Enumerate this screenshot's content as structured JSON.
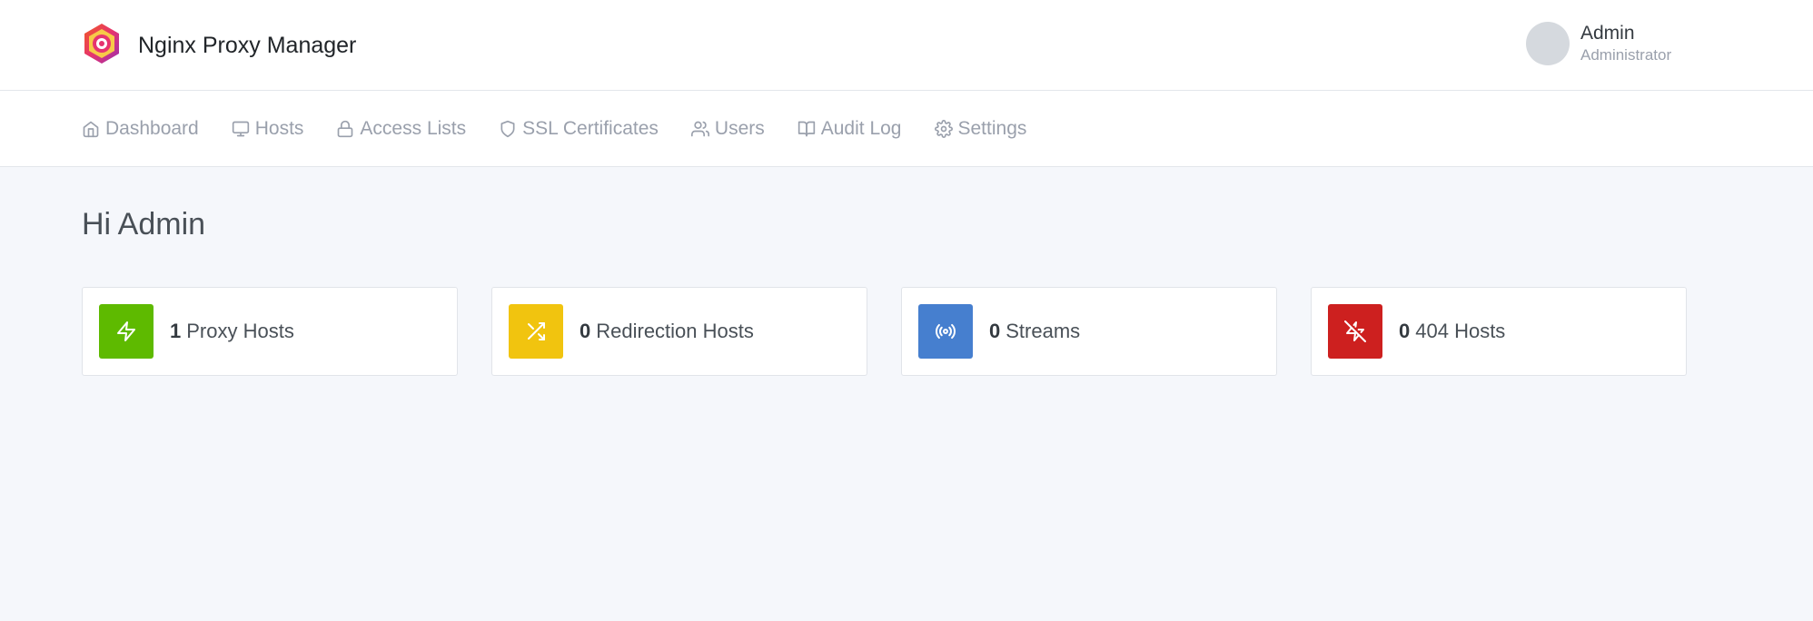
{
  "app": {
    "name": "Nginx Proxy Manager"
  },
  "user": {
    "name": "Admin",
    "role": "Administrator"
  },
  "nav": {
    "items": [
      {
        "label": "Dashboard",
        "icon": "home-icon"
      },
      {
        "label": "Hosts",
        "icon": "monitor-icon"
      },
      {
        "label": "Access Lists",
        "icon": "lock-icon"
      },
      {
        "label": "SSL Certificates",
        "icon": "shield-icon"
      },
      {
        "label": "Users",
        "icon": "users-icon"
      },
      {
        "label": "Audit Log",
        "icon": "book-icon"
      },
      {
        "label": "Settings",
        "icon": "gear-icon"
      }
    ]
  },
  "main": {
    "greeting": "Hi Admin",
    "cards": [
      {
        "count": "1",
        "label": "Proxy Hosts",
        "icon": "zap-icon",
        "color": "#5eba00"
      },
      {
        "count": "0",
        "label": "Redirection Hosts",
        "icon": "shuffle-icon",
        "color": "#f1c40f"
      },
      {
        "count": "0",
        "label": "Streams",
        "icon": "radio-icon",
        "color": "#467fcf"
      },
      {
        "count": "0",
        "label": "404 Hosts",
        "icon": "zap-off-icon",
        "color": "#cd201f"
      }
    ]
  }
}
